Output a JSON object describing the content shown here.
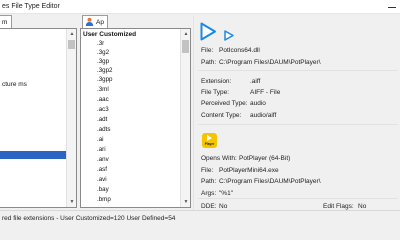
{
  "window": {
    "title": "es File Type Editor"
  },
  "tabs": [
    {
      "label": "m"
    },
    {
      "label": "Ap"
    }
  ],
  "left_list": {
    "items": [
      "cture ms"
    ]
  },
  "ext_list": {
    "header": "User Customized",
    "items": [
      ".3r",
      ".3g2",
      ".3gp",
      ".3gp2",
      ".3gpp",
      ".3ml",
      ".aac",
      ".ac3",
      ".adt",
      ".adts",
      ".ai",
      ".ari",
      ".anv",
      ".asf",
      ".avi",
      ".bay",
      ".bmp"
    ]
  },
  "details": {
    "file_label": "File:",
    "file_value": "PotIcons64.dll",
    "path_label": "Path:",
    "path_value": "C:\\Program Files\\DAUM\\PotPlayer\\",
    "extension_label": "Extension:",
    "extension_value": ".aiff",
    "filetype_label": "File Type:",
    "filetype_value": "AIFF - File",
    "perceived_label": "Perceived Type:",
    "perceived_value": "audio",
    "content_label": "Content Type:",
    "content_value": "audio/aiff"
  },
  "open_with": {
    "icon_text": "Player",
    "opens_label": "Opens With:",
    "opens_value": "PotPlayer (64-Bit)",
    "file_label": "File:",
    "file_value": "PotPlayerMini64.exe",
    "path_label": "Path:",
    "path_value": "C:\\Program Files\\DAUM\\PotPlayer\\",
    "args_label": "Args:",
    "args_value": "\"%1\"",
    "dde_label": "DDE:",
    "dde_value": "No",
    "editflags_label": "Edit Flags:",
    "editflags_value": "No"
  },
  "status": {
    "text": "red file extensions - User Customized=120  User Defined=54"
  },
  "colors": {
    "accent": "#1e88e5",
    "selection": "#2a64c5",
    "player_icon": "#f5c400"
  }
}
